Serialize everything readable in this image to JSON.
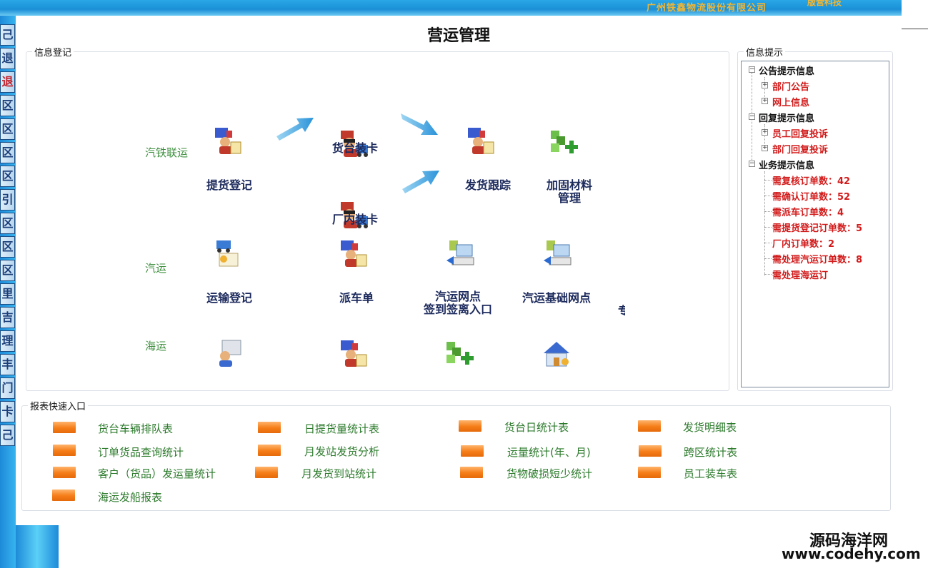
{
  "banner": {
    "company": "广州铁鑫物流股份有限公司",
    "company_suffix": "版营科技"
  },
  "left_strip": {
    "tabs": [
      {
        "label": "己",
        "red": false
      },
      {
        "label": "退",
        "red": false
      },
      {
        "label": "退",
        "red": true
      },
      {
        "label": "区",
        "red": false
      },
      {
        "label": "区",
        "red": false
      },
      {
        "label": "区",
        "red": false
      },
      {
        "label": "区",
        "red": false
      },
      {
        "label": "引",
        "red": false
      },
      {
        "label": "区",
        "red": false
      },
      {
        "label": "区",
        "red": false
      },
      {
        "label": "区",
        "red": false
      },
      {
        "label": "里",
        "red": false
      },
      {
        "label": "吉",
        "red": false
      },
      {
        "label": "理",
        "red": false
      },
      {
        "label": "丰",
        "red": false
      },
      {
        "label": "门",
        "red": false
      },
      {
        "label": "卡",
        "red": false
      },
      {
        "label": "己",
        "red": false
      }
    ]
  },
  "page": {
    "title": "营运管理"
  },
  "info_reg": {
    "legend": "信息登记",
    "rows": {
      "rail": "汽铁联运",
      "road": "汽运",
      "sea": "海运"
    },
    "nodes": {
      "pickup_reg": "提货登记",
      "platform_load": "货台装卡",
      "factory_load": "厂内装卡",
      "shipment_track": "发货跟踪",
      "reinforce_line1": "加固材料",
      "reinforce_line2": "管理",
      "transport_reg": "运输登记",
      "dispatch": "派车单",
      "outlet_checkin_line1": "汽运网点",
      "outlet_checkin_line2": "签到签离入口",
      "outlet_base": "汽运基础网点",
      "cut_char": "专"
    }
  },
  "info_tips": {
    "legend": "信息提示",
    "tree": {
      "announce": {
        "label": "公告提示信息",
        "children": [
          "部门公告",
          "网上信息"
        ]
      },
      "reply": {
        "label": "回复提示信息",
        "children": [
          "员工回复投诉",
          "部门回复投诉"
        ]
      },
      "business": {
        "label": "业务提示信息",
        "children": [
          "需复核订单数：42",
          "需确认订单数：52",
          "需派车订单数：4",
          "需提货登记订单数：5",
          "厂内订单数：2",
          "需处理汽运订单数：8",
          "需处理海运订"
        ]
      }
    }
  },
  "reports": {
    "legend": "报表快速入口",
    "items": [
      "货台车辆排队表",
      "日提货量统计表",
      "货台日统计表",
      "发货明细表",
      "订单货品查询统计",
      "月发站发货分析",
      "运量统计(年、月)",
      "跨区统计表",
      "客户（货品）发运量统计",
      "月发货到站统计",
      "货物破损短少统计",
      "员工装车表",
      "海运发船报表"
    ]
  },
  "watermark": {
    "name": "源码海洋网",
    "url": "www.codehy.com"
  },
  "colors": {
    "tree_red": "#d21b1b",
    "row_green": "#3f8f3f",
    "node_navy": "#1c2a5c",
    "report_orange": "#f57d18",
    "banner_blue": "#1b8fd6"
  }
}
